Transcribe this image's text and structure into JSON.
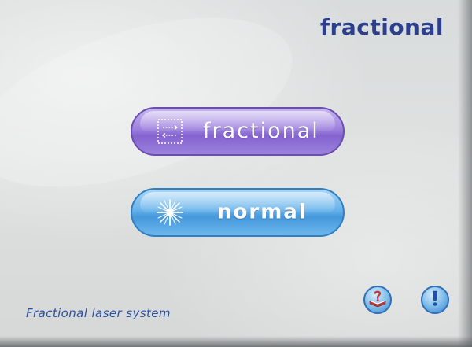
{
  "header": {
    "brand_title": "fractional"
  },
  "modes": {
    "fractional": {
      "label": "fractional",
      "icon": "fractional-dots-icon"
    },
    "normal": {
      "label": "normal",
      "icon": "laser-burst-icon"
    }
  },
  "footer": {
    "caption": "Fractional laser system",
    "help_icon": "help-book-icon",
    "info_icon": "info-exclamation-icon"
  },
  "colors": {
    "brand_text": "#2b3f8c",
    "fractional_button": "#9d80de",
    "normal_button": "#4598db",
    "caption_text": "#2b4f9e"
  }
}
